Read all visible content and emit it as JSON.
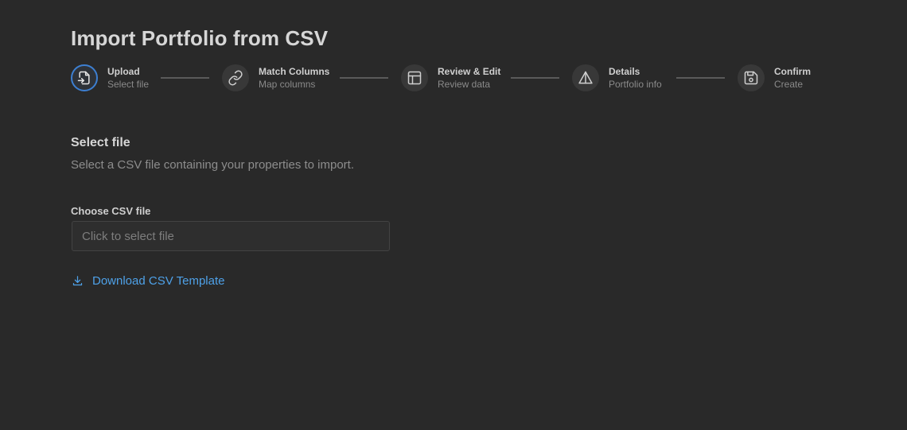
{
  "page": {
    "title": "Import Portfolio from CSV"
  },
  "stepper": {
    "steps": [
      {
        "label": "Upload",
        "sublabel": "Select file",
        "icon": "file-import-icon",
        "active": true
      },
      {
        "label": "Match Columns",
        "sublabel": "Map columns",
        "icon": "link-icon",
        "active": false
      },
      {
        "label": "Review & Edit",
        "sublabel": "Review data",
        "icon": "table-icon",
        "active": false
      },
      {
        "label": "Details",
        "sublabel": "Portfolio info",
        "icon": "triangle-split-icon",
        "active": false
      },
      {
        "label": "Confirm",
        "sublabel": "Create",
        "icon": "save-icon",
        "active": false
      }
    ]
  },
  "section": {
    "title": "Select file",
    "description": "Select a CSV file containing your properties to import."
  },
  "file_field": {
    "label": "Choose CSV file",
    "placeholder": "Click to select file"
  },
  "download": {
    "label": "Download CSV Template",
    "icon": "download-icon"
  },
  "colors": {
    "background": "#292929",
    "accent": "#3d7fd1",
    "link": "#4ea1e8"
  }
}
